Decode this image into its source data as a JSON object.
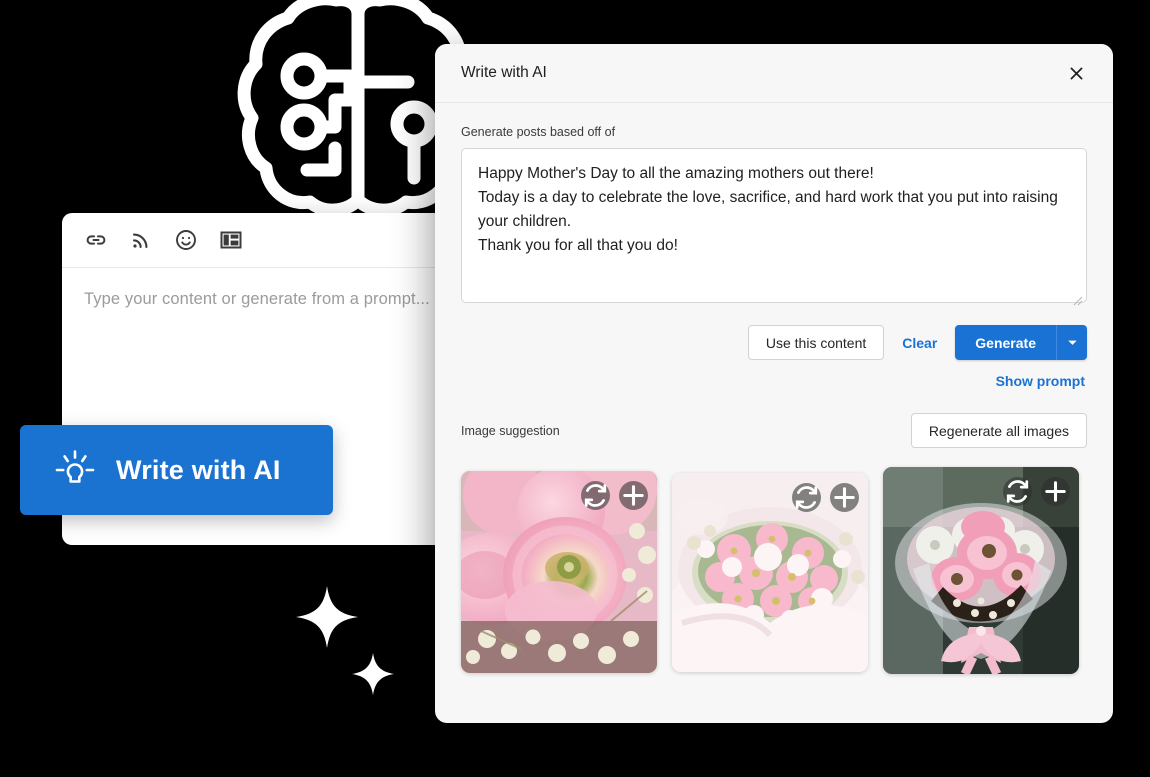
{
  "decor": {
    "brain_icon": "brain-circuit-icon",
    "sparkles": [
      "sparkle-large",
      "sparkle-small"
    ]
  },
  "editor_panel": {
    "toolbar": [
      {
        "icon": "link-icon",
        "name": "insert-link"
      },
      {
        "icon": "rss-icon",
        "name": "rss-feed"
      },
      {
        "icon": "emoji-icon",
        "name": "insert-emoji"
      },
      {
        "icon": "layout-grid-icon",
        "name": "layout-template"
      }
    ],
    "composer_placeholder": "Type your content or generate from a prompt..."
  },
  "cta": {
    "icon": "lightbulb-idea-icon",
    "label": "Write with AI",
    "color": "#1b73d1"
  },
  "modal": {
    "title": "Write with AI",
    "close_icon": "close-icon",
    "prompt": {
      "label": "Generate posts based off of",
      "value": "Happy Mother's Day to all the amazing mothers out there!\nToday is a day to celebrate the love, sacrifice, and hard work that you put into raising your children.\nThank you for all that you do!",
      "placeholder": "Generate posts based off of"
    },
    "actions": {
      "use_this_content": "Use this content",
      "clear": "Clear",
      "generate": "Generate",
      "generate_caret_icon": "chevron-down-icon",
      "show_prompt": "Show prompt"
    },
    "images": {
      "section_label": "Image suggestion",
      "regenerate_all": "Regenerate all images",
      "cards": [
        {
          "alt": "Pink ranunculus roses with baby's breath close-up",
          "regenerate_icon": "refresh-icon",
          "add_icon": "plus-icon"
        },
        {
          "alt": "Pale pink bouquet of carnations and daisies in white wrapping",
          "regenerate_icon": "refresh-icon",
          "add_icon": "plus-icon"
        },
        {
          "alt": "Pink gerbera bouquet with ribbon bow",
          "regenerate_icon": "refresh-icon",
          "add_icon": "plus-icon"
        }
      ]
    }
  },
  "colors": {
    "accent_blue": "#1a73d4",
    "cta_blue": "#1b73d1",
    "modal_bg": "#f7f7f7",
    "page_bg": "#000000"
  }
}
